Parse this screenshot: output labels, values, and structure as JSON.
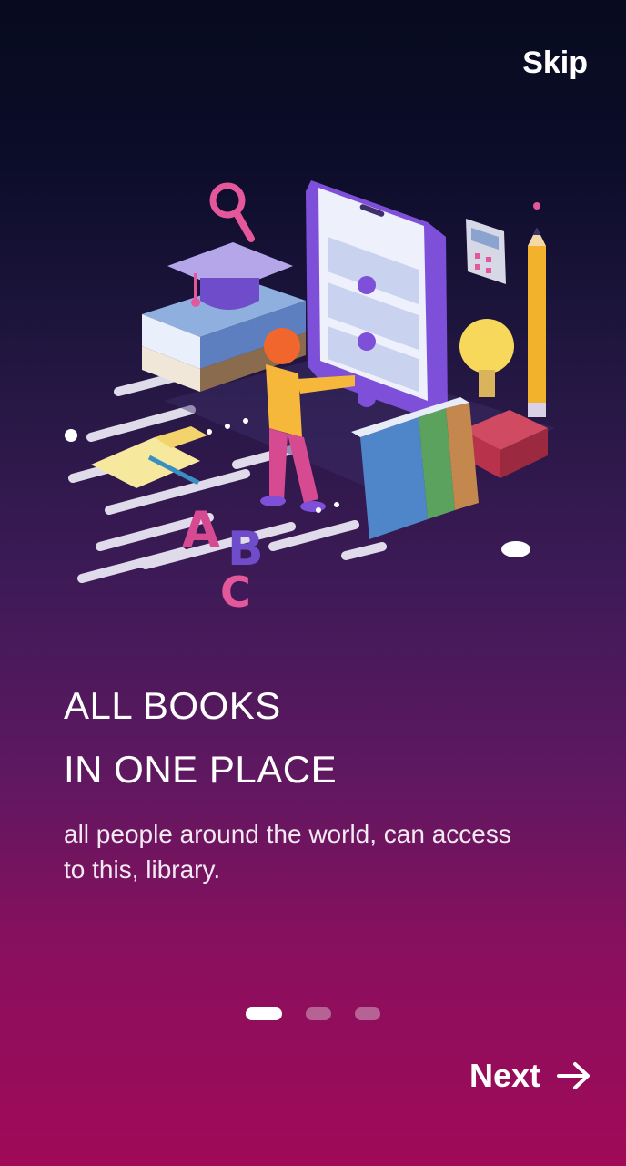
{
  "header": {
    "skip_label": "Skip"
  },
  "onboarding": {
    "headline_line1": "ALL BOOKS",
    "headline_line2": "IN ONE PLACE",
    "subtitle": "all people around the world, can access to this, library.",
    "current_page": 1,
    "total_pages": 3
  },
  "footer": {
    "next_label": "Next"
  },
  "icons": {
    "next": "arrow-right-icon",
    "hero": "library-illustration"
  },
  "colors": {
    "background_top": "#070b1e",
    "background_bottom": "#a00a58",
    "text": "#ffffff",
    "dot_active": "#ffffff",
    "dot_inactive": "#b7739a"
  }
}
